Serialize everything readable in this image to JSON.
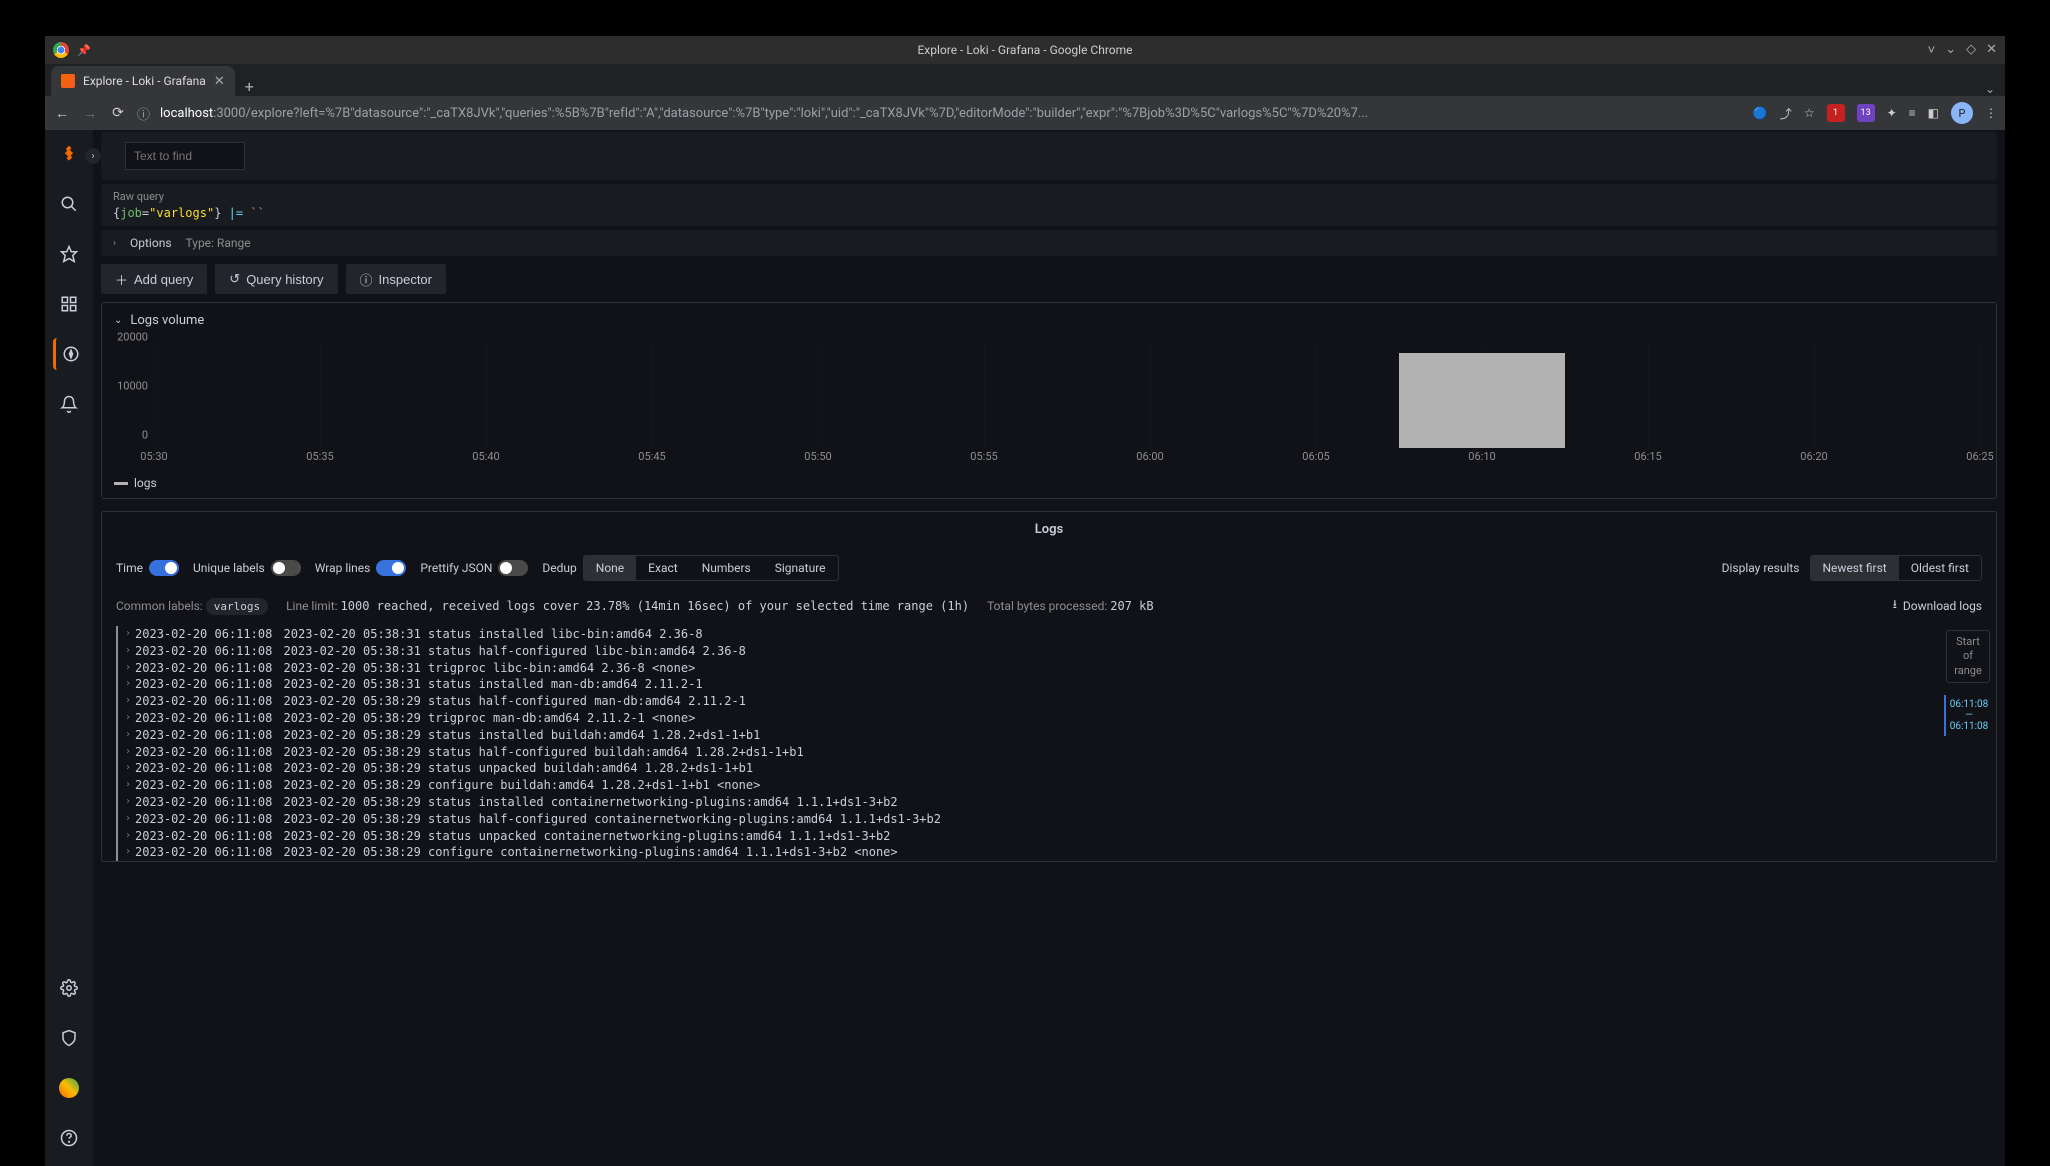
{
  "window": {
    "title": "Explore - Loki - Grafana - Google Chrome"
  },
  "tab": {
    "title": "Explore - Loki - Grafana"
  },
  "url": {
    "host": "localhost",
    "path": ":3000/explore?left=%7B\"datasource\":\"_caTX8JVk\",\"queries\":%5B%7B\"refId\":\"A\",\"datasource\":%7B\"type\":\"loki\",\"uid\":\"_caTX8JVk\"%7D,\"editorMode\":\"builder\",\"expr\":\"%7Bjob%3D%5C\"varlogs%5C\"%7D%20%7..."
  },
  "ext_badges": {
    "ublock": "1",
    "inbox": "13"
  },
  "profile": "P",
  "search": {
    "placeholder": "Text to find"
  },
  "raw_query": {
    "label": "Raw query",
    "key": "job",
    "value": "\"varlogs\"",
    "pipe": "|=",
    "tick": "``"
  },
  "options": {
    "caret": "›",
    "label": "Options",
    "type_label": "Type: Range"
  },
  "buttons": {
    "add_query": "Add query",
    "history": "Query history",
    "inspector": "Inspector"
  },
  "section": {
    "logs_volume": "Logs volume"
  },
  "chart_data": {
    "type": "bar",
    "title": "Logs volume",
    "ylabel": "",
    "xlabel": "",
    "ylim": [
      0,
      22000
    ],
    "y_ticks": [
      0,
      10000,
      20000
    ],
    "x_ticks": [
      "05:30",
      "05:35",
      "05:40",
      "05:45",
      "05:50",
      "05:55",
      "06:00",
      "06:05",
      "06:10",
      "06:15",
      "06:20",
      "06:25"
    ],
    "categories": [
      "06:10"
    ],
    "values": [
      20000
    ],
    "series_name": "logs",
    "legend": "logs"
  },
  "logs_panel": {
    "title": "Logs",
    "toggles": {
      "time": "Time",
      "unique": "Unique labels",
      "wrap": "Wrap lines",
      "prettify": "Prettify JSON"
    },
    "dedup_label": "Dedup",
    "dedup_opts": [
      "None",
      "Exact",
      "Numbers",
      "Signature"
    ],
    "display_label": "Display results",
    "display_opts": [
      "Newest first",
      "Oldest first"
    ]
  },
  "meta": {
    "common_labels_label": "Common labels:",
    "common_label_value": "varlogs",
    "line_limit_label": "Line limit:",
    "line_limit_value": "1000 reached, received logs cover 23.78% (14min 16sec) of your selected time range (1h)",
    "total_bytes_label": "Total bytes processed:",
    "total_bytes_value": "207 kB",
    "download": "Download logs"
  },
  "side": {
    "start_of_range": "Start\nof\nrange",
    "t1": "06:11:08",
    "dash": "—",
    "t2": "06:11:08"
  },
  "log_lines": [
    {
      "ts": "2023-02-20 06:11:08",
      "text": "2023-02-20 05:38:31 status installed libc-bin:amd64 2.36-8"
    },
    {
      "ts": "2023-02-20 06:11:08",
      "text": "2023-02-20 05:38:31 status half-configured libc-bin:amd64 2.36-8"
    },
    {
      "ts": "2023-02-20 06:11:08",
      "text": "2023-02-20 05:38:31 trigproc libc-bin:amd64 2.36-8 <none>"
    },
    {
      "ts": "2023-02-20 06:11:08",
      "text": "2023-02-20 05:38:31 status installed man-db:amd64 2.11.2-1"
    },
    {
      "ts": "2023-02-20 06:11:08",
      "text": "2023-02-20 05:38:29 status half-configured man-db:amd64 2.11.2-1"
    },
    {
      "ts": "2023-02-20 06:11:08",
      "text": "2023-02-20 05:38:29 trigproc man-db:amd64 2.11.2-1 <none>"
    },
    {
      "ts": "2023-02-20 06:11:08",
      "text": "2023-02-20 05:38:29 status installed buildah:amd64 1.28.2+ds1-1+b1"
    },
    {
      "ts": "2023-02-20 06:11:08",
      "text": "2023-02-20 05:38:29 status half-configured buildah:amd64 1.28.2+ds1-1+b1"
    },
    {
      "ts": "2023-02-20 06:11:08",
      "text": "2023-02-20 05:38:29 status unpacked buildah:amd64 1.28.2+ds1-1+b1"
    },
    {
      "ts": "2023-02-20 06:11:08",
      "text": "2023-02-20 05:38:29 configure buildah:amd64 1.28.2+ds1-1+b1 <none>"
    },
    {
      "ts": "2023-02-20 06:11:08",
      "text": "2023-02-20 05:38:29 status installed containernetworking-plugins:amd64 1.1.1+ds1-3+b2"
    },
    {
      "ts": "2023-02-20 06:11:08",
      "text": "2023-02-20 05:38:29 status half-configured containernetworking-plugins:amd64 1.1.1+ds1-3+b2"
    },
    {
      "ts": "2023-02-20 06:11:08",
      "text": "2023-02-20 05:38:29 status unpacked containernetworking-plugins:amd64 1.1.1+ds1-3+b2"
    },
    {
      "ts": "2023-02-20 06:11:08",
      "text": "2023-02-20 05:38:29 configure containernetworking-plugins:amd64 1.1.1+ds1-3+b2 <none>"
    }
  ]
}
